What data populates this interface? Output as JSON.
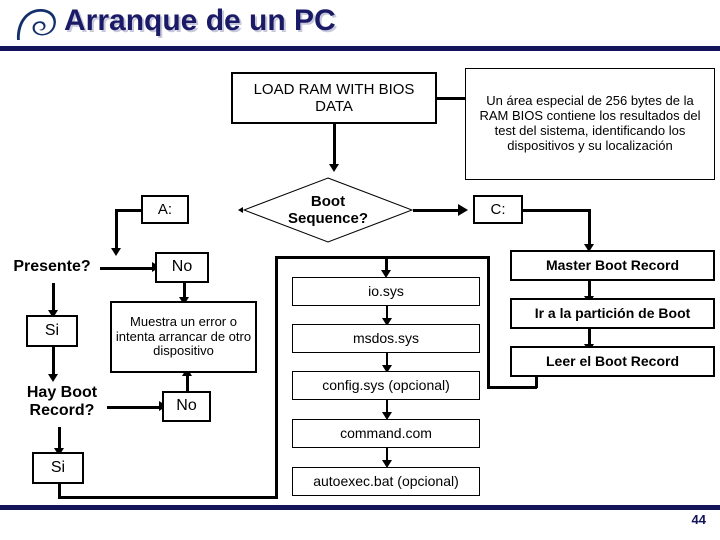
{
  "slide": {
    "title": "Arranque de un PC",
    "page_number": "44",
    "accent_color": "#14145a",
    "title_color": "#1a1a66",
    "logo_icon": "swirl-logo-icon"
  },
  "nodes": {
    "load_ram": "LOAD RAM WITH\nBIOS DATA",
    "note_bios": "Un área especial de 256 bytes de la RAM BIOS contiene los resultados del test del sistema, identificando los dispositivos y su localización",
    "boot_sequence": "Boot\nSequence?",
    "drive_a": "A:",
    "drive_c": "C:",
    "presente": "Presente?",
    "presente_no": "No",
    "presente_si": "Si",
    "error_box": "Muestra un error o\nintenta arrancar de\notro dispositivo",
    "hay_boot_record": "Hay Boot\nRecord?",
    "hay_boot_no": "No",
    "hay_boot_si": "Si",
    "io_sys": "io.sys",
    "msdos_sys": "msdos.sys",
    "config_sys": "config.sys (opcional)",
    "command_com": "command.com",
    "autoexec_bat": "autoexec.bat (opcional)",
    "master_boot_record": "Master Boot Record",
    "ir_particion": "Ir a la partición de Boot",
    "leer_boot_record": "Leer el Boot Record"
  }
}
